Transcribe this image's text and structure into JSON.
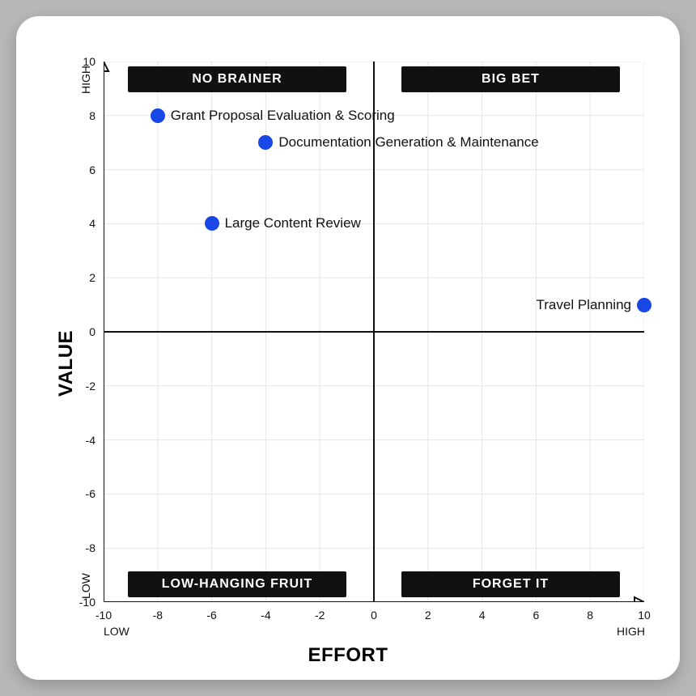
{
  "chart_data": {
    "type": "scatter",
    "title": "",
    "xlabel": "EFFORT",
    "ylabel": "VALUE",
    "xlim": [
      -10,
      10
    ],
    "ylim": [
      -10,
      10
    ],
    "xticks": [
      -10,
      -8,
      -6,
      -4,
      -2,
      0,
      2,
      4,
      6,
      8,
      10
    ],
    "yticks": [
      -10,
      -8,
      -6,
      -4,
      -2,
      0,
      2,
      4,
      6,
      8,
      10
    ],
    "x_endlabels": {
      "low": "LOW",
      "high": "HIGH"
    },
    "y_endlabels": {
      "low": "LOW",
      "high": "HIGH"
    },
    "quadrants": {
      "top_left": "NO BRAINER",
      "top_right": "BIG BET",
      "bottom_left": "LOW-HANGING FRUIT",
      "bottom_right": "FORGET IT"
    },
    "series": [
      {
        "name": "items",
        "points": [
          {
            "x": -8,
            "y": 8,
            "label": "Grant Proposal Evaluation & Scoring",
            "label_side": "right"
          },
          {
            "x": -4,
            "y": 7,
            "label": "Documentation Generation & Maintenance",
            "label_side": "right"
          },
          {
            "x": -6,
            "y": 4,
            "label": "Large Content Review",
            "label_side": "right"
          },
          {
            "x": 10,
            "y": 1,
            "label": "Travel Planning",
            "label_side": "left"
          }
        ]
      }
    ]
  }
}
